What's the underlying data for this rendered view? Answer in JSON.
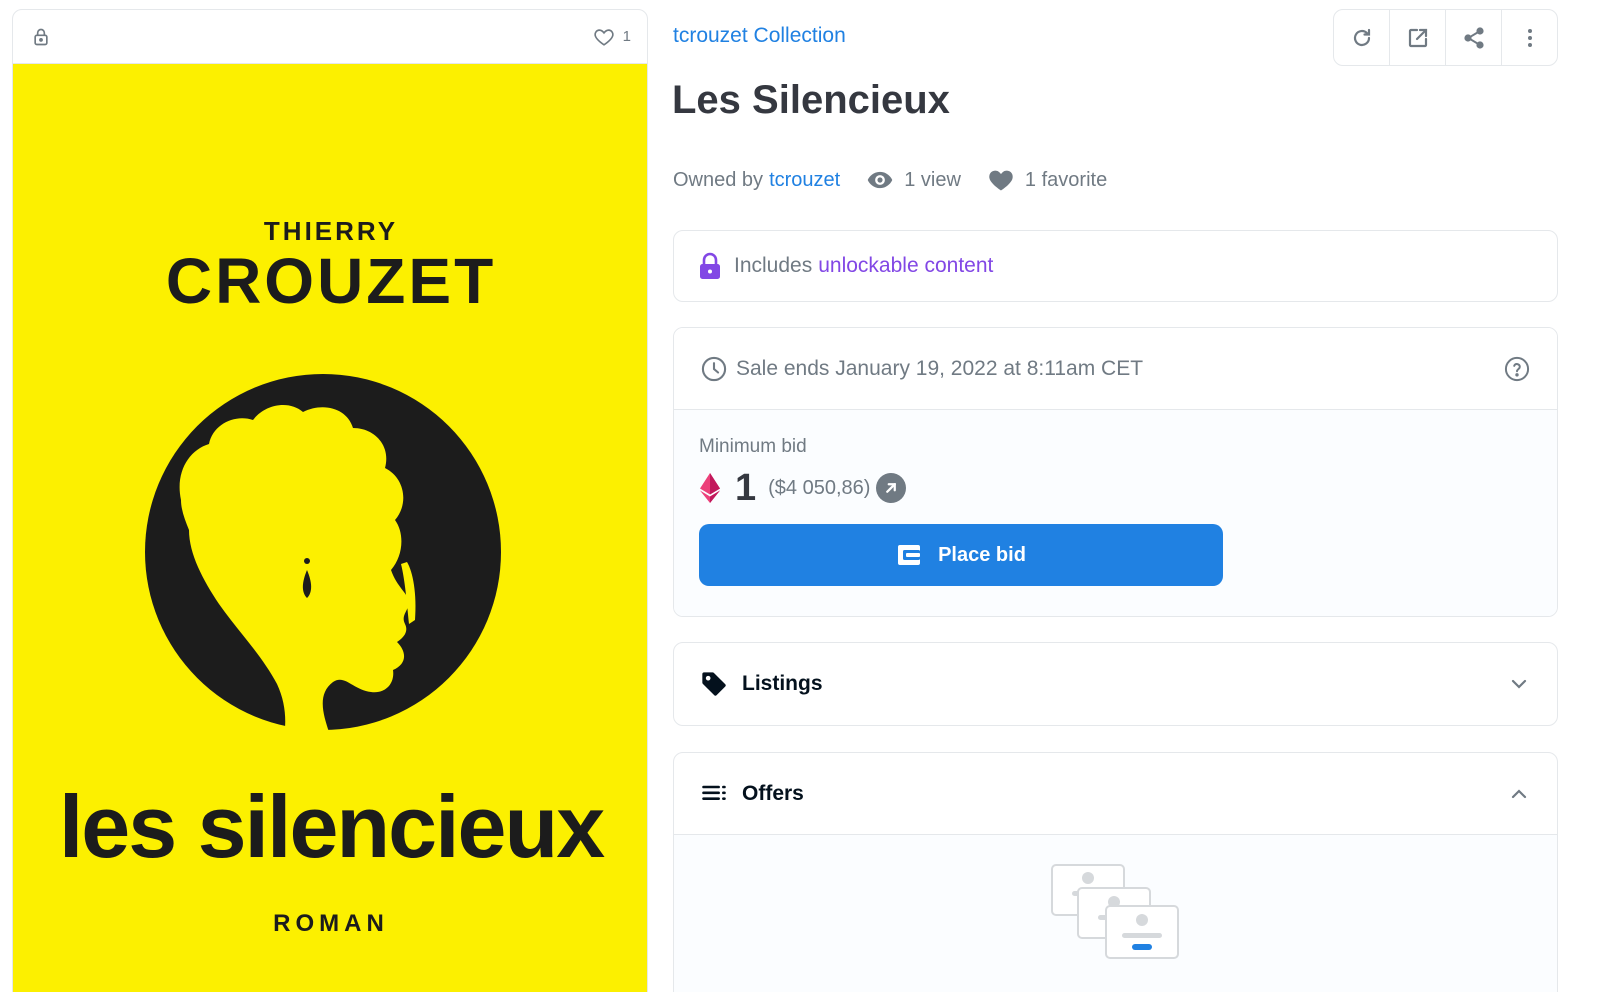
{
  "media": {
    "favorite_count": "1",
    "cover": {
      "author_first": "THIERRY",
      "author_last": "CROUZET",
      "title": "les silencieux",
      "genre": "ROMAN",
      "background_color": "#fcf000"
    }
  },
  "collection": {
    "name": "tcrouzet Collection"
  },
  "toolbar": {
    "icons": [
      "refresh-icon",
      "external-link-icon",
      "share-icon",
      "more-icon"
    ]
  },
  "item": {
    "title": "Les Silencieux",
    "owned_by_label": "Owned by",
    "owner": "tcrouzet",
    "views": "1 view",
    "favorites": "1 favorite"
  },
  "unlockable": {
    "prefix": "Includes",
    "link": "unlockable content"
  },
  "sale": {
    "ends_text": "Sale ends January 19, 2022 at 8:11am CET",
    "min_bid_label": "Minimum bid",
    "price": "1",
    "usd": "($4 050,86)",
    "place_bid_label": "Place bid"
  },
  "listings": {
    "label": "Listings"
  },
  "offers": {
    "label": "Offers"
  },
  "colors": {
    "accent": "#2081e2",
    "unlockable": "#8247e5",
    "text_secondary": "#707a83"
  }
}
